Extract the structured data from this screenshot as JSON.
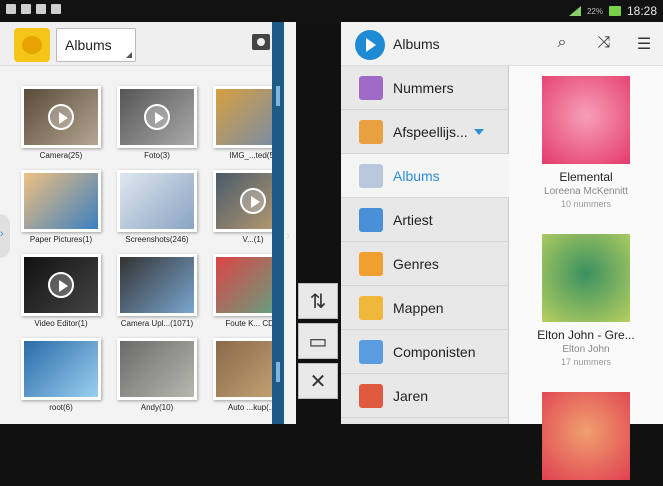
{
  "status_bar": {
    "time": "18:28",
    "battery": "22%"
  },
  "gallery": {
    "dropdown": "Albums",
    "tiles": [
      {
        "label": "Camera(25)",
        "colors": [
          "#5a4a3a",
          "#b4a690"
        ],
        "video": true
      },
      {
        "label": "Foto(3)",
        "colors": [
          "#555",
          "#aaa"
        ],
        "video": true
      },
      {
        "label": "IMG_...ted(5)",
        "colors": [
          "#d8a040",
          "#6d8ab0"
        ],
        "video": false
      },
      {
        "label": "Paper Pictures(1)",
        "colors": [
          "#f0c080",
          "#3a80c0"
        ],
        "video": false
      },
      {
        "label": "Screenshots(246)",
        "colors": [
          "#dfe6ee",
          "#8aa4c4"
        ],
        "video": false
      },
      {
        "label": "V...(1)",
        "colors": [
          "#4a5a6a",
          "#c0a070"
        ],
        "video": true
      },
      {
        "label": "Video Editor(1)",
        "colors": [
          "#111",
          "#444"
        ],
        "video": true
      },
      {
        "label": "Camera Upl...(1071)",
        "colors": [
          "#333",
          "#7aa6d0"
        ],
        "video": false
      },
      {
        "label": "Foute K... CD...",
        "colors": [
          "#d44",
          "#5a8"
        ],
        "video": false
      },
      {
        "label": "root(6)",
        "colors": [
          "#2a6aa8",
          "#9ad0f0"
        ],
        "video": false
      },
      {
        "label": "Andy(10)",
        "colors": [
          "#6a6a6a",
          "#b8b8b0"
        ],
        "video": false
      },
      {
        "label": "Auto ...kup(...)",
        "colors": [
          "#8a6a4a",
          "#c8a878"
        ],
        "video": false
      }
    ]
  },
  "music": {
    "title": "Albums",
    "icons": {
      "search": "search-icon",
      "shuffle": "shuffle-icon",
      "menu": "menu-icon"
    },
    "nav": [
      {
        "label": "Nummers",
        "color": "#a06ac8",
        "active": false,
        "dropdown": false
      },
      {
        "label": "Afspeellijs...",
        "color": "#e8a040",
        "active": false,
        "dropdown": true
      },
      {
        "label": "Albums",
        "color": "#b9c8dc",
        "active": true,
        "dropdown": false
      },
      {
        "label": "Artiest",
        "color": "#4a90d8",
        "active": false,
        "dropdown": false
      },
      {
        "label": "Genres",
        "color": "#f0a030",
        "active": false,
        "dropdown": false
      },
      {
        "label": "Mappen",
        "color": "#f0b83a",
        "active": false,
        "dropdown": false
      },
      {
        "label": "Componisten",
        "color": "#5a9ce0",
        "active": false,
        "dropdown": false
      },
      {
        "label": "Jaren",
        "color": "#e05a40",
        "active": false,
        "dropdown": false
      }
    ],
    "albums": [
      {
        "title": "Elemental",
        "artist": "Loreena McKennitt",
        "count": "10 nummers",
        "colors": [
          "#e43a6a",
          "#f7a0b8"
        ]
      },
      {
        "title": "Elton John - Gre...",
        "artist": "Elton John",
        "count": "17 nummers",
        "colors": [
          "#b8d060",
          "#3a9060"
        ]
      },
      {
        "title": "",
        "artist": "",
        "count": "",
        "colors": [
          "#e04050",
          "#f0a070"
        ]
      }
    ]
  }
}
